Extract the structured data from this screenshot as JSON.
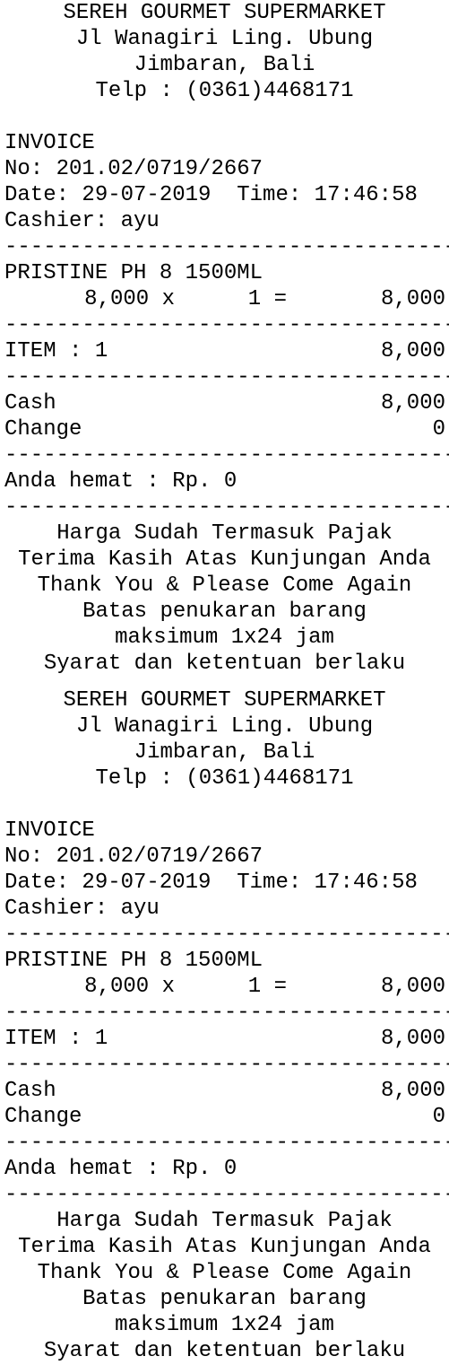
{
  "receipts": [
    {
      "store_name": "SEREH GOURMET SUPERMARKET",
      "address_line1": "Jl Wanagiri Ling. Ubung",
      "address_line2": "Jimbaran, Bali",
      "phone": "Telp : (0361)4468171",
      "doc_type": "INVOICE",
      "number": "No: 201.02/0719/2667",
      "date_time": "Date: 29-07-2019  Time: 17:46:58",
      "cashier": "Cashier: ayu",
      "separator": "------------------------------------------",
      "item_name": "PRISTINE PH 8 1500ML",
      "item_price": "8,000 x",
      "item_qty": "1 =",
      "item_total": "8,000",
      "item_count_label": "ITEM : 1",
      "item_count_total": "8,000",
      "cash_label": "Cash",
      "cash_value": "8,000",
      "change_label": "Change",
      "change_value": "0",
      "savings": "Anda hemat : Rp. 0",
      "footer1": "Harga Sudah Termasuk Pajak",
      "footer2": "Terima Kasih Atas Kunjungan Anda",
      "footer3": "Thank You & Please Come Again",
      "footer4": "Batas penukaran barang",
      "footer5": "maksimum 1x24 jam",
      "footer6": "Syarat dan ketentuan berlaku"
    },
    {
      "store_name": "SEREH GOURMET SUPERMARKET",
      "address_line1": "Jl Wanagiri Ling. Ubung",
      "address_line2": "Jimbaran, Bali",
      "phone": "Telp : (0361)4468171",
      "doc_type": "INVOICE",
      "number": "No: 201.02/0719/2667",
      "date_time": "Date: 29-07-2019  Time: 17:46:58",
      "cashier": "Cashier: ayu",
      "separator": "------------------------------------------",
      "item_name": "PRISTINE PH 8 1500ML",
      "item_price": "8,000 x",
      "item_qty": "1 =",
      "item_total": "8,000",
      "item_count_label": "ITEM : 1",
      "item_count_total": "8,000",
      "cash_label": "Cash",
      "cash_value": "8,000",
      "change_label": "Change",
      "change_value": "0",
      "savings": "Anda hemat : Rp. 0",
      "footer1": "Harga Sudah Termasuk Pajak",
      "footer2": "Terima Kasih Atas Kunjungan Anda",
      "footer3": "Thank You & Please Come Again",
      "footer4": "Batas penukaran barang",
      "footer5": "maksimum 1x24 jam",
      "footer6": "Syarat dan ketentuan berlaku"
    }
  ]
}
